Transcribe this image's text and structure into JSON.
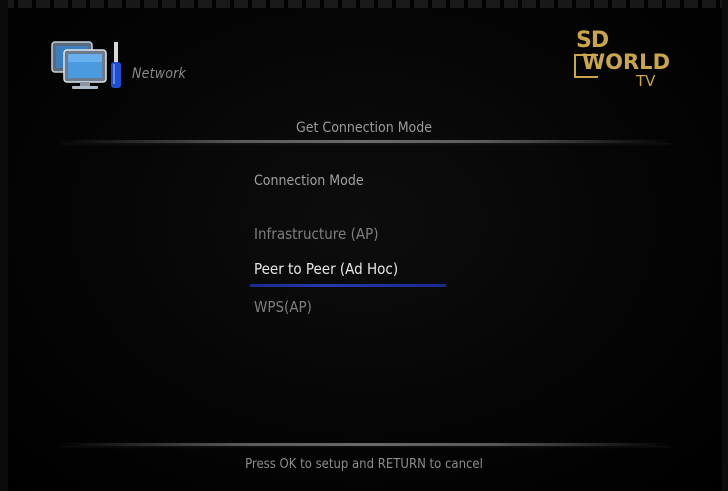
{
  "header": {
    "section_title": "Network",
    "icon": "network-computer-icon",
    "logo": {
      "line1": "SD",
      "line2": "WORLD",
      "line3": "TV",
      "brand_color": "#c9a64a"
    }
  },
  "page": {
    "title": "Get Connection Mode"
  },
  "connection_mode": {
    "heading": "Connection Mode",
    "options": [
      "Infrastructure (AP)",
      "Peer to Peer (Ad Hoc)",
      "WPS(AP)"
    ],
    "selected": "Peer to Peer (Ad Hoc)",
    "highlight_color": "#2638b0"
  },
  "footer": {
    "hint": "Press OK to setup and RETURN to cancel"
  }
}
